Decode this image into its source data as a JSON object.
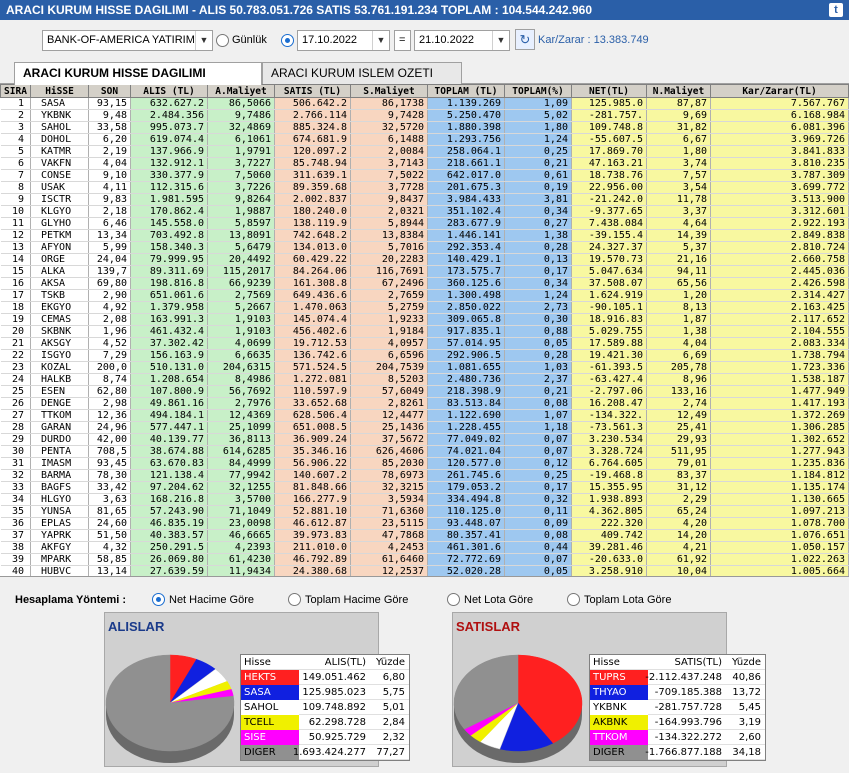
{
  "title": "ARACI KURUM HISSE DAGILIMI - ALIS 50.783.051.726  SATIS 53.761.191.234  TOPLAM : 104.544.242.960",
  "toolbar": {
    "broker": "BANK-OF-AMERICA YATIRIM",
    "gunluk": "Günlük",
    "date_from": "17.10.2022",
    "equals": "=",
    "date_to": "21.10.2022",
    "karzarar": "Kar/Zarar : 13.383.749"
  },
  "tabs": [
    "ARACI KURUM HISSE DAGILIMI",
    "ARACI KURUM ISLEM OZETI"
  ],
  "table": {
    "headers": [
      "SIRA",
      "HiSSE",
      "SON",
      "ALIS (TL)",
      "A.Maliyet",
      "SATIS (TL)",
      "S.Maliyet",
      "TOPLAM (TL)",
      "TOPLAM(%)",
      "NET(TL)",
      "N.Maliyet",
      "Kar/Zarar(TL)"
    ],
    "rows": [
      [
        "1",
        "SASA",
        "93,15",
        "632.627.2",
        "86,5066",
        "506.642.2",
        "86,1738",
        "1.139.269",
        "1,09",
        "125.985.0",
        "87,87",
        "7.567.767"
      ],
      [
        "2",
        "YKBNK",
        "9,48",
        "2.484.356",
        "9,7486",
        "2.766.114",
        "9,7428",
        "5.250.470",
        "5,02",
        "-281.757.",
        "9,69",
        "6.168.984"
      ],
      [
        "3",
        "SAHOL",
        "33,58",
        "995.073.7",
        "32,4869",
        "885.324.8",
        "32,5720",
        "1.880.398",
        "1,80",
        "109.748.8",
        "31,82",
        "6.081.396"
      ],
      [
        "4",
        "DOHOL",
        "6,20",
        "619.074.4",
        "6,1061",
        "674.681.9",
        "6,1488",
        "1.293.756",
        "1,24",
        "-55.607.5",
        "6,67",
        "3.969.726"
      ],
      [
        "5",
        "KATMR",
        "2,19",
        "137.966.9",
        "1,9791",
        "120.097.2",
        "2,0084",
        "258.064.1",
        "0,25",
        "17.869.70",
        "1,80",
        "3.841.833"
      ],
      [
        "6",
        "VAKFN",
        "4,04",
        "132.912.1",
        "3,7227",
        "85.748.94",
        "3,7143",
        "218.661.1",
        "0,21",
        "47.163.21",
        "3,74",
        "3.810.235"
      ],
      [
        "7",
        "CONSE",
        "9,10",
        "330.377.9",
        "7,5060",
        "311.639.1",
        "7,5022",
        "642.017.0",
        "0,61",
        "18.738.76",
        "7,57",
        "3.787.309"
      ],
      [
        "8",
        "USAK",
        "4,11",
        "112.315.6",
        "3,7226",
        "89.359.68",
        "3,7728",
        "201.675.3",
        "0,19",
        "22.956.00",
        "3,54",
        "3.699.772"
      ],
      [
        "9",
        "ISCTR",
        "9,83",
        "1.981.595",
        "9,8264",
        "2.002.837",
        "9,8437",
        "3.984.433",
        "3,81",
        "-21.242.0",
        "11,78",
        "3.513.900"
      ],
      [
        "10",
        "KLGYO",
        "2,18",
        "170.862.4",
        "1,9887",
        "180.240.0",
        "2,0321",
        "351.102.4",
        "0,34",
        "-9.377.65",
        "3,37",
        "3.312.601"
      ],
      [
        "11",
        "GLYHO",
        "6,46",
        "145.558.0",
        "5,8597",
        "138.119.9",
        "5,8944",
        "283.677.9",
        "0,27",
        "7.438.084",
        "4,64",
        "2.922.193"
      ],
      [
        "12",
        "PETKM",
        "13,34",
        "703.492.8",
        "13,8091",
        "742.648.2",
        "13,8384",
        "1.446.141",
        "1,38",
        "-39.155.4",
        "14,39",
        "2.849.838"
      ],
      [
        "13",
        "AFYON",
        "5,99",
        "158.340.3",
        "5,6479",
        "134.013.0",
        "5,7016",
        "292.353.4",
        "0,28",
        "24.327.37",
        "5,37",
        "2.810.724"
      ],
      [
        "14",
        "ORGE",
        "24,04",
        "79.999.95",
        "20,4492",
        "60.429.22",
        "20,2283",
        "140.429.1",
        "0,13",
        "19.570.73",
        "21,16",
        "2.660.758"
      ],
      [
        "15",
        "ALKA",
        "139,7",
        "89.311.69",
        "115,2017",
        "84.264.06",
        "116,7691",
        "173.575.7",
        "0,17",
        "5.047.634",
        "94,11",
        "2.445.036"
      ],
      [
        "16",
        "AKSA",
        "69,80",
        "198.816.8",
        "66,9239",
        "161.308.8",
        "67,2496",
        "360.125.6",
        "0,34",
        "37.508.07",
        "65,56",
        "2.426.598"
      ],
      [
        "17",
        "TSKB",
        "2,90",
        "651.061.6",
        "2,7569",
        "649.436.6",
        "2,7659",
        "1.300.498",
        "1,24",
        "1.624.919",
        "1,20",
        "2.314.427"
      ],
      [
        "18",
        "EKGYO",
        "4,92",
        "1.379.958",
        "5,2667",
        "1.470.063",
        "5,2759",
        "2.850.022",
        "2,73",
        "-90.105.1",
        "8,13",
        "2.163.425"
      ],
      [
        "19",
        "CEMAS",
        "2,08",
        "163.991.3",
        "1,9103",
        "145.074.4",
        "1,9233",
        "309.065.8",
        "0,30",
        "18.916.83",
        "1,87",
        "2.117.652"
      ],
      [
        "20",
        "SKBNK",
        "1,96",
        "461.432.4",
        "1,9103",
        "456.402.6",
        "1,9184",
        "917.835.1",
        "0,88",
        "5.029.755",
        "1,38",
        "2.104.555"
      ],
      [
        "21",
        "AKSGY",
        "4,52",
        "37.302.42",
        "4,0699",
        "19.712.53",
        "4,0957",
        "57.014.95",
        "0,05",
        "17.589.88",
        "4,04",
        "2.083.334"
      ],
      [
        "22",
        "ISGYO",
        "7,29",
        "156.163.9",
        "6,6635",
        "136.742.6",
        "6,6596",
        "292.906.5",
        "0,28",
        "19.421.30",
        "6,69",
        "1.738.794"
      ],
      [
        "23",
        "KOZAL",
        "200,0",
        "510.131.0",
        "204,6315",
        "571.524.5",
        "204,7539",
        "1.081.655",
        "1,03",
        "-61.393.5",
        "205,78",
        "1.723.336"
      ],
      [
        "24",
        "HALKB",
        "8,74",
        "1.208.654",
        "8,4986",
        "1.272.081",
        "8,5203",
        "2.480.736",
        "2,37",
        "-63.427.4",
        "8,96",
        "1.538.187"
      ],
      [
        "25",
        "ESEN",
        "62,80",
        "107.800.9",
        "56,7692",
        "110.597.9",
        "57,6049",
        "218.398.9",
        "0,21",
        "-2.797.06",
        "133,16",
        "1.477.949"
      ],
      [
        "26",
        "DENGE",
        "2,98",
        "49.861.16",
        "2,7976",
        "33.652.68",
        "2,8261",
        "83.513.84",
        "0,08",
        "16.208.47",
        "2,74",
        "1.417.193"
      ],
      [
        "27",
        "TTKOM",
        "12,36",
        "494.184.1",
        "12,4369",
        "628.506.4",
        "12,4477",
        "1.122.690",
        "1,07",
        "-134.322.",
        "12,49",
        "1.372.269"
      ],
      [
        "28",
        "GARAN",
        "24,96",
        "577.447.1",
        "25,1099",
        "651.008.5",
        "25,1436",
        "1.228.455",
        "1,18",
        "-73.561.3",
        "25,41",
        "1.306.285"
      ],
      [
        "29",
        "DURDO",
        "42,00",
        "40.139.77",
        "36,8113",
        "36.909.24",
        "37,5672",
        "77.049.02",
        "0,07",
        "3.230.534",
        "29,93",
        "1.302.652"
      ],
      [
        "30",
        "PENTA",
        "708,5",
        "38.674.88",
        "614,6285",
        "35.346.16",
        "626,4606",
        "74.021.04",
        "0,07",
        "3.328.724",
        "511,95",
        "1.277.943"
      ],
      [
        "31",
        "IMASM",
        "93,45",
        "63.670.83",
        "84,4999",
        "56.906.22",
        "85,2030",
        "120.577.0",
        "0,12",
        "6.764.605",
        "79,01",
        "1.235.836"
      ],
      [
        "32",
        "BARMA",
        "78,30",
        "121.138.4",
        "77,9942",
        "140.607.2",
        "78,6973",
        "261.745.6",
        "0,25",
        "-19.468.8",
        "83,37",
        "1.184.812"
      ],
      [
        "33",
        "BAGFS",
        "33,42",
        "97.204.62",
        "32,1255",
        "81.848.66",
        "32,3215",
        "179.053.2",
        "0,17",
        "15.355.95",
        "31,12",
        "1.135.174"
      ],
      [
        "34",
        "HLGYO",
        "3,63",
        "168.216.8",
        "3,5700",
        "166.277.9",
        "3,5934",
        "334.494.8",
        "0,32",
        "1.938.893",
        "2,29",
        "1.130.665"
      ],
      [
        "35",
        "YUNSA",
        "81,65",
        "57.243.90",
        "71,1049",
        "52.881.10",
        "71,6360",
        "110.125.0",
        "0,11",
        "4.362.805",
        "65,24",
        "1.097.213"
      ],
      [
        "36",
        "EPLAS",
        "24,60",
        "46.835.19",
        "23,0098",
        "46.612.87",
        "23,5115",
        "93.448.07",
        "0,09",
        "222.320",
        "4,20",
        "1.078.700"
      ],
      [
        "37",
        "YAPRK",
        "51,50",
        "40.383.57",
        "46,6665",
        "39.973.83",
        "47,7868",
        "80.357.41",
        "0,08",
        "409.742",
        "14,20",
        "1.076.651"
      ],
      [
        "38",
        "AKFGY",
        "4,32",
        "250.291.5",
        "4,2393",
        "211.010.0",
        "4,2453",
        "461.301.6",
        "0,44",
        "39.281.46",
        "4,21",
        "1.050.157"
      ],
      [
        "39",
        "MPARK",
        "58,85",
        "26.069.80",
        "61,4230",
        "46.792.89",
        "61,6460",
        "72.772.69",
        "0,07",
        "-20.633.0",
        "61,92",
        "1.022.263"
      ],
      [
        "40",
        "HUBVC",
        "13,14",
        "27.639.59",
        "11,9434",
        "24.380.68",
        "12,2537",
        "52.020.28",
        "0,05",
        "3.258.910",
        "10,04",
        "1.005.664"
      ]
    ]
  },
  "hesaplama": {
    "label": "Hesaplama Yöntemi :",
    "options": [
      "Net Hacime Göre",
      "Toplam Hacime Göre",
      "Net Lota Göre",
      "Toplam Lota Göre"
    ]
  },
  "alislar": {
    "title": "ALISLAR",
    "headers": [
      "Hisse",
      "ALIS(TL)",
      "Yüzde"
    ],
    "rows": [
      {
        "name": "HEKTS",
        "value": "149.051.462",
        "pct": "6,80",
        "pct_num": 6.8,
        "color": "#ff2020",
        "text": "#ffffff"
      },
      {
        "name": "SASA",
        "value": "125.985.023",
        "pct": "5,75",
        "pct_num": 5.75,
        "color": "#1020e0",
        "text": "#ffffff"
      },
      {
        "name": "SAHOL",
        "value": "109.748.892",
        "pct": "5,01",
        "pct_num": 5.01,
        "color": "#ffffff",
        "text": "#000000"
      },
      {
        "name": "TCELL",
        "value": "62.298.728",
        "pct": "2,84",
        "pct_num": 2.84,
        "color": "#f0f000",
        "text": "#000000"
      },
      {
        "name": "SISE",
        "value": "50.925.729",
        "pct": "2,32",
        "pct_num": 2.32,
        "color": "#ff00ff",
        "text": "#ffffff"
      },
      {
        "name": "DIGER",
        "value": "1.693.424.277",
        "pct": "77,27",
        "pct_num": 77.27,
        "color": "#909090",
        "text": "#000000"
      }
    ]
  },
  "satislar": {
    "title": "SATISLAR",
    "headers": [
      "Hisse",
      "SATIS(TL)",
      "Yüzde"
    ],
    "rows": [
      {
        "name": "TUPRS",
        "value": "-2.112.437.248",
        "pct": "40,86",
        "pct_num": 40.86,
        "color": "#ff2020",
        "text": "#ffffff"
      },
      {
        "name": "THYAO",
        "value": "-709.185.388",
        "pct": "13,72",
        "pct_num": 13.72,
        "color": "#1020e0",
        "text": "#ffffff"
      },
      {
        "name": "YKBNK",
        "value": "-281.757.728",
        "pct": "5,45",
        "pct_num": 5.45,
        "color": "#ffffff",
        "text": "#000000"
      },
      {
        "name": "AKBNK",
        "value": "-164.993.796",
        "pct": "3,19",
        "pct_num": 3.19,
        "color": "#f0f000",
        "text": "#000000"
      },
      {
        "name": "TTKOM",
        "value": "-134.322.272",
        "pct": "2,60",
        "pct_num": 2.6,
        "color": "#ff00ff",
        "text": "#ffffff"
      },
      {
        "name": "DIGER",
        "value": "-1.766.877.188",
        "pct": "34,18",
        "pct_num": 34.18,
        "color": "#909090",
        "text": "#000000"
      }
    ]
  }
}
